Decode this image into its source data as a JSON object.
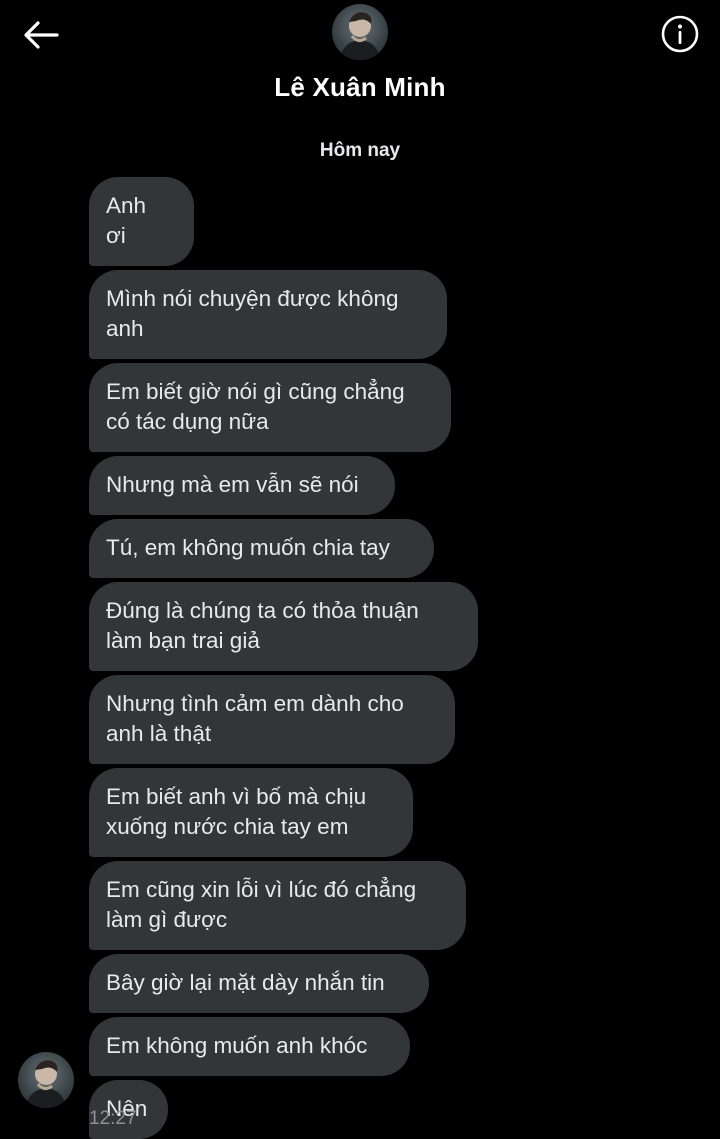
{
  "header": {
    "back_icon": "arrow-left-icon",
    "info_icon": "info-circle-icon",
    "contact_name": "Lê Xuân Minh"
  },
  "conversation": {
    "date_separator": "Hôm nay",
    "messages": [
      {
        "text": "Anh ơi"
      },
      {
        "text": "Mình nói chuyện được không anh"
      },
      {
        "text": "Em biết giờ nói gì cũng chẳng có tác dụng nữa"
      },
      {
        "text": "Nhưng mà em vẫn sẽ nói"
      },
      {
        "text": "Tú, em không muốn chia tay"
      },
      {
        "text": "Đúng là chúng ta có thỏa thuận làm bạn trai giả"
      },
      {
        "text": "Nhưng tình cảm em dành cho anh là thật"
      },
      {
        "text": "Em biết anh vì bố mà chịu xuống nước chia tay em"
      },
      {
        "text": "Em cũng xin lỗi vì lúc đó chẳng làm gì được"
      },
      {
        "text": "Bây giờ lại mặt dày nhắn tin"
      },
      {
        "text": "Em không muốn anh khóc"
      },
      {
        "text": "Nên"
      }
    ],
    "last_timestamp": "12:27"
  },
  "colors": {
    "background": "#000000",
    "bubble": "#333639",
    "text": "#e7e9ea",
    "timestamp": "#8b9196"
  }
}
